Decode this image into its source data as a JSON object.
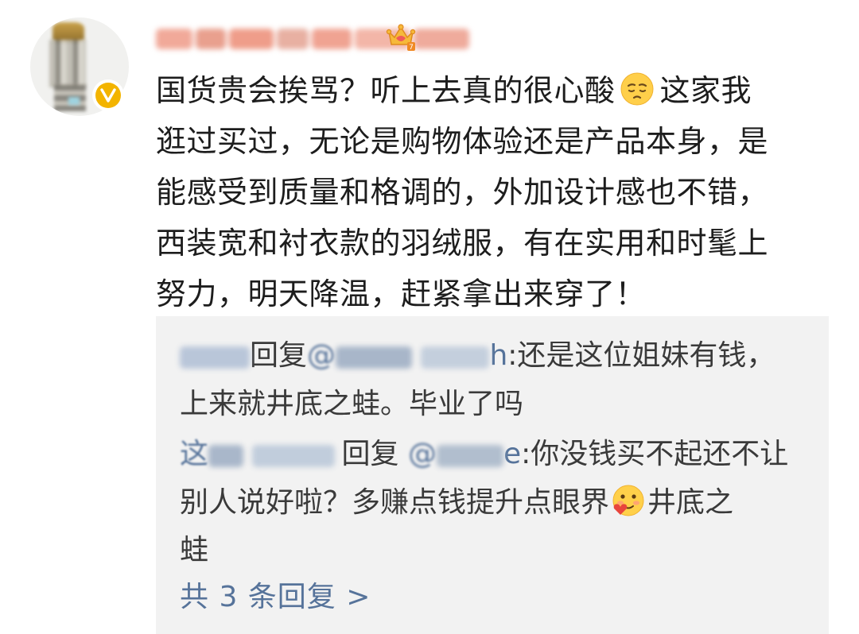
{
  "post": {
    "author_verified_icon": "verified-v-icon",
    "crown_icon": "crown-icon",
    "lines": [
      "国货贵会挨骂？听上去真的很心酸",
      "这家我",
      "逛过买过，无论是购物体验还是产品本身，是",
      "能感受到质量和格调的，外加设计感也不错，",
      "西装宽和衬衣款的羽绒服，有在实用和时髦上",
      "努力，明天降温，赶紧拿出来穿了！"
    ],
    "emoji": "pensive-face-emoji"
  },
  "replies": [
    {
      "reply_word": "回复",
      "at_prefix": "@",
      "name_tail": "h",
      "line1": ":还是这位姐妹有钱，",
      "line2": "上来就井底之蛙。毕业了吗"
    },
    {
      "name_head": "这",
      "reply_word": "回复",
      "at_prefix": "@",
      "name_tail": "e",
      "line1": ":你没钱买不起还不让",
      "line2a": "别人说好啦？多赚点钱提升点眼界",
      "line2b": "井底之",
      "line3": "蛙",
      "emoji": "yummy-face-emoji"
    }
  ],
  "more_replies_label": "共 3 条回复 >",
  "colors": {
    "link": "#56739a",
    "text": "#1d1d1d",
    "reply_bg": "#f2f2f2",
    "verified": "#f3b400"
  }
}
